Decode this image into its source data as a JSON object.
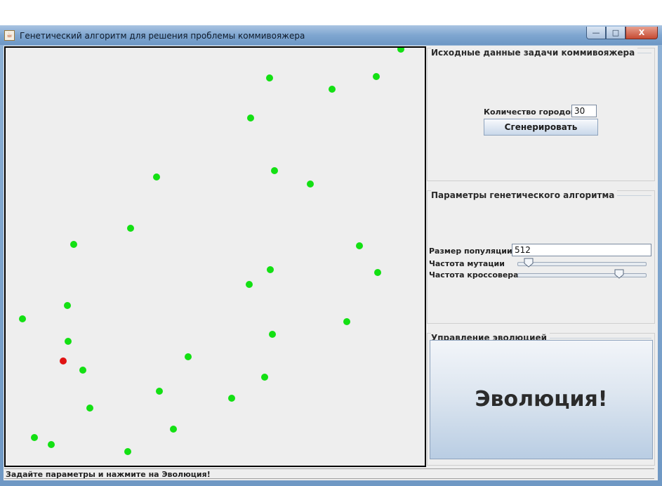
{
  "window": {
    "title": "Генетический алгоритм для решения проблемы коммивояжера",
    "title_icon": "java-cup-icon",
    "controls": {
      "minimize": "—",
      "maximize": "□",
      "close": "X"
    }
  },
  "canvas": {
    "city_colors": {
      "normal": "#13e013",
      "start": "#e01313"
    },
    "cities_count_shown": 30
  },
  "task_panel": {
    "title": "Исходные данные задачи коммивояжера",
    "cities_label": "Количество городов:",
    "cities_value": "30",
    "generate_button": "Сгенерировать"
  },
  "ga_panel": {
    "title": "Параметры генетического алгоритма",
    "population_label": "Размер популяции",
    "population_value": "512",
    "mutation_label": "Частота мутации",
    "mutation_value": 0.05,
    "crossover_label": "Частота кроссовера",
    "crossover_value": 0.81
  },
  "evolution_panel": {
    "title": "Управление эволюцией",
    "evolve_button": "Эволюция!"
  },
  "status_bar": {
    "text": "Задайте параметры и нажмите на Эволюция!"
  }
}
